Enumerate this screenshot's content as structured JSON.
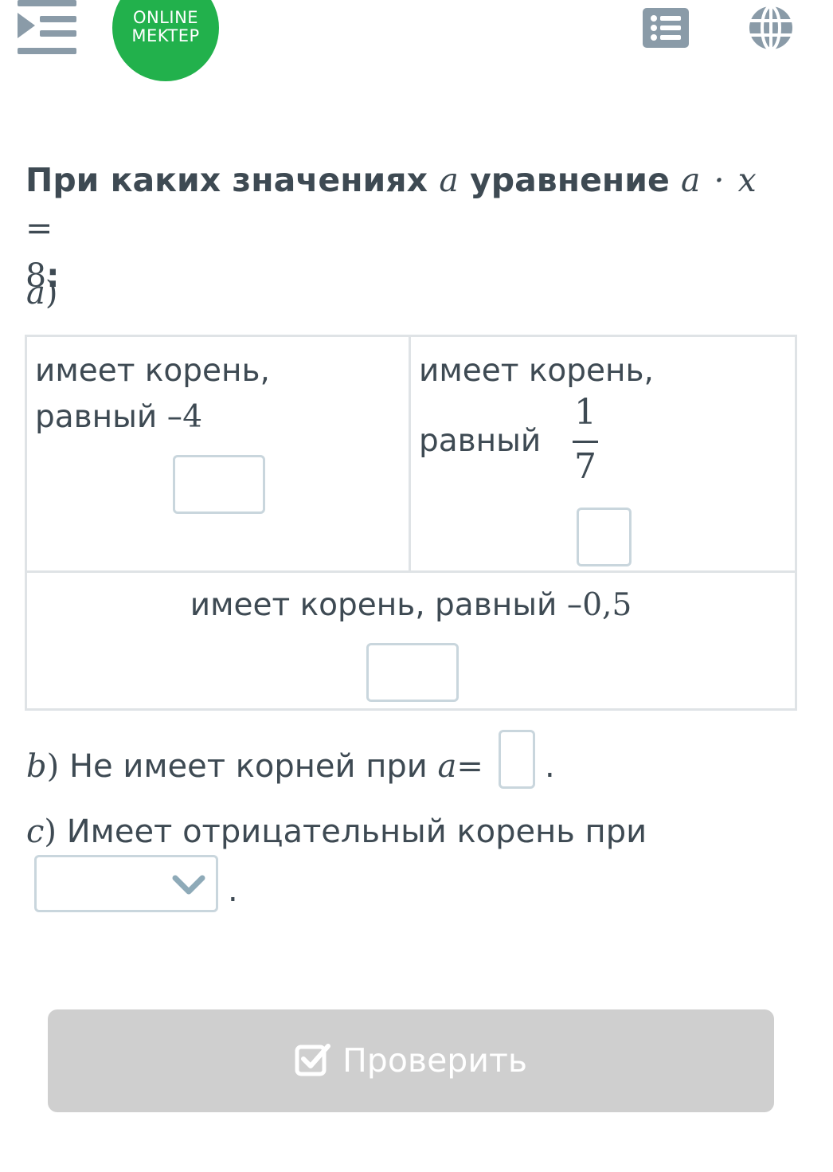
{
  "header": {
    "logo_line1": "ONLINE",
    "logo_line2": "MEKTEP",
    "icons": [
      "menu-indent-icon",
      "list-icon",
      "globe-icon"
    ],
    "brand_color": "#22b14c"
  },
  "question": {
    "prefix": "При каких значениях",
    "var": "a",
    "middle": "уравнение",
    "equation": "a · x =",
    "rhs": "8",
    "colon": ":"
  },
  "part_a": {
    "label": "a",
    "paren": ")",
    "cells": [
      {
        "line1": "имеет корень,",
        "line2_text": "равный –",
        "line2_num": "4"
      },
      {
        "line1": "имеет корень,",
        "line2_text": "равный",
        "frac_num": "1",
        "frac_den": "7"
      },
      {
        "text": "имеет корень, равный –",
        "num": "0,5"
      }
    ]
  },
  "part_b": {
    "label": "b",
    "paren": ")",
    "text": "Не имеет корней при",
    "var": "a",
    "eq": "=",
    "dot": "."
  },
  "part_c": {
    "label": "c",
    "paren": ")",
    "text": "Имеет отрицательный корень при",
    "selected": "",
    "dot": "."
  },
  "check_button": {
    "label": "Проверить"
  }
}
